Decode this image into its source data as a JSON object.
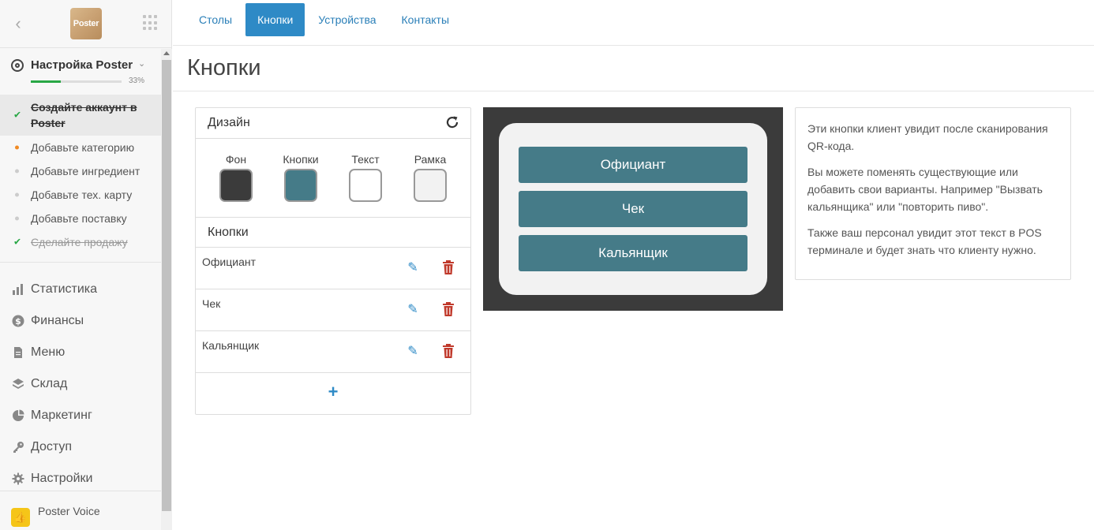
{
  "sidebar": {
    "logo_text": "Poster",
    "setup": {
      "title": "Настройка Poster",
      "progress": 0.33,
      "progress_label": "33%",
      "steps": [
        {
          "label": "Создайте аккаунт в Poster",
          "state": "done-active"
        },
        {
          "label": "Добавьте категорию",
          "state": "current"
        },
        {
          "label": "Добавьте ингредиент",
          "state": "pending"
        },
        {
          "label": "Добавьте тех. карту",
          "state": "pending"
        },
        {
          "label": "Добавьте поставку",
          "state": "pending"
        },
        {
          "label": "Сделайте продажу",
          "state": "done"
        }
      ]
    },
    "nav": [
      {
        "label": "Статистика",
        "icon": "bar-chart-icon"
      },
      {
        "label": "Финансы",
        "icon": "dollar-icon"
      },
      {
        "label": "Меню",
        "icon": "document-icon"
      },
      {
        "label": "Склад",
        "icon": "layers-icon"
      },
      {
        "label": "Маркетинг",
        "icon": "pie-chart-icon"
      },
      {
        "label": "Доступ",
        "icon": "key-icon"
      },
      {
        "label": "Настройки",
        "icon": "gear-icon"
      }
    ],
    "voice": {
      "label": "Poster Voice",
      "icon": "thumbs-up-icon"
    }
  },
  "tabs": [
    {
      "label": "Столы",
      "active": false
    },
    {
      "label": "Кнопки",
      "active": true
    },
    {
      "label": "Устройства",
      "active": false
    },
    {
      "label": "Контакты",
      "active": false
    }
  ],
  "page_title": "Кнопки",
  "design": {
    "title": "Дизайн",
    "swatches": [
      {
        "label": "Фон",
        "color": "#3b3b3b"
      },
      {
        "label": "Кнопки",
        "color": "#457b88"
      },
      {
        "label": "Текст",
        "color": "#ffffff"
      },
      {
        "label": "Рамка",
        "color": "#f2f2f2"
      }
    ],
    "buttons_title": "Кнопки",
    "buttons": [
      {
        "name": "Официант"
      },
      {
        "name": "Чек"
      },
      {
        "name": "Кальянщик"
      }
    ]
  },
  "preview": {
    "buttons": [
      "Официант",
      "Чек",
      "Кальянщик"
    ]
  },
  "info": {
    "paragraphs": [
      "Эти кнопки клиент увидит после сканирования QR-кода.",
      "Вы можете поменять существующие или добавить свои варианты. Например \"Вызвать кальянщика\" или \"повторить пиво\".",
      "Также ваш персонал увидит этот текст в POS терминале и будет знать что клиенту нужно."
    ]
  },
  "colors": {
    "accent": "#2e8ac6",
    "success": "#28a745",
    "warning": "#f08a24",
    "danger": "#c0392b"
  }
}
